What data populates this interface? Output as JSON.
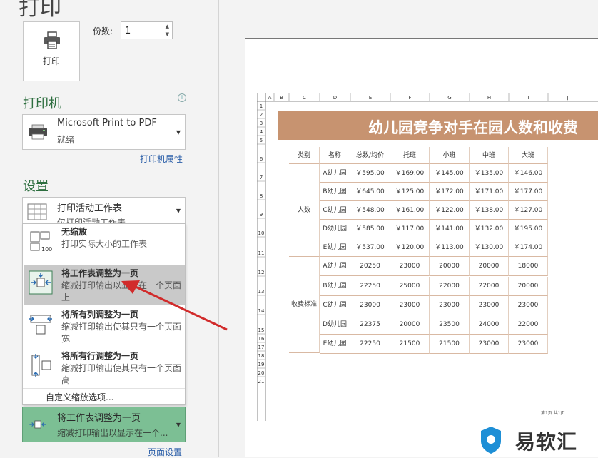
{
  "page_title": "打印",
  "print_button": {
    "label": "打印"
  },
  "copies": {
    "label": "份数:",
    "value": "1"
  },
  "printer": {
    "section_title": "打印机",
    "name": "Microsoft Print to PDF",
    "status": "就绪",
    "properties_link": "打印机属性"
  },
  "settings": {
    "section_title": "设置",
    "print_what": {
      "title": "打印活动工作表",
      "desc": "仅打印活动工作表"
    }
  },
  "scaling_menu": {
    "items": [
      {
        "title": "无缩放",
        "desc": "打印实际大小的工作表"
      },
      {
        "title": "将工作表调整为一页",
        "desc": "缩减打印输出以显示在一个页面上"
      },
      {
        "title": "将所有列调整为一页",
        "desc": "缩减打印输出使其只有一个页面宽"
      },
      {
        "title": "将所有行调整为一页",
        "desc": "缩减打印输出使其只有一个页面高"
      }
    ],
    "custom": "自定义缩放选项..."
  },
  "scaling_selected": {
    "title": "将工作表调整为一页",
    "desc": "缩减打印输出以显示在一个..."
  },
  "page_setup_link": "页面设置",
  "preview": {
    "columns": [
      "A",
      "B",
      "C",
      "D",
      "E",
      "F",
      "G",
      "H",
      "I",
      "J"
    ],
    "rows": [
      "1",
      "2",
      "3",
      "4",
      "5",
      "6",
      "7",
      "8",
      "9",
      "10",
      "11",
      "12",
      "13",
      "14",
      "15",
      "16",
      "17",
      "18",
      "19",
      "20",
      "21"
    ],
    "banner": "幼儿园竞争对手在园人数和收费",
    "headers": [
      "类别",
      "名称",
      "总数/均价",
      "托班",
      "小班",
      "中班",
      "大班"
    ],
    "group1": "人数",
    "group2": "收费标准",
    "names": [
      "A幼儿园",
      "B幼儿园",
      "C幼儿园",
      "D幼儿园",
      "E幼儿园"
    ],
    "block1": [
      [
        "￥595.00",
        "￥169.00",
        "￥145.00",
        "￥135.00",
        "￥146.00"
      ],
      [
        "￥645.00",
        "￥125.00",
        "￥172.00",
        "￥171.00",
        "￥177.00"
      ],
      [
        "￥548.00",
        "￥161.00",
        "￥122.00",
        "￥138.00",
        "￥127.00"
      ],
      [
        "￥585.00",
        "￥117.00",
        "￥141.00",
        "￥132.00",
        "￥195.00"
      ],
      [
        "￥537.00",
        "￥120.00",
        "￥113.00",
        "￥130.00",
        "￥174.00"
      ]
    ],
    "block2": [
      [
        "20250",
        "23000",
        "20000",
        "20000",
        "18000"
      ],
      [
        "22250",
        "25000",
        "22000",
        "22000",
        "20000"
      ],
      [
        "23000",
        "23000",
        "23000",
        "23000",
        "23000"
      ],
      [
        "22375",
        "20000",
        "23500",
        "24000",
        "22000"
      ],
      [
        "22250",
        "21500",
        "21500",
        "23000",
        "23000"
      ]
    ],
    "footer_text": "第1页 共1页"
  },
  "watermark": {
    "text": "易软汇"
  },
  "colors": {
    "accent": "#2d6e3f",
    "selected": "#7cbf94",
    "banner": "#c79370",
    "link": "#2a5ea8",
    "arrow": "#d12b2b"
  }
}
